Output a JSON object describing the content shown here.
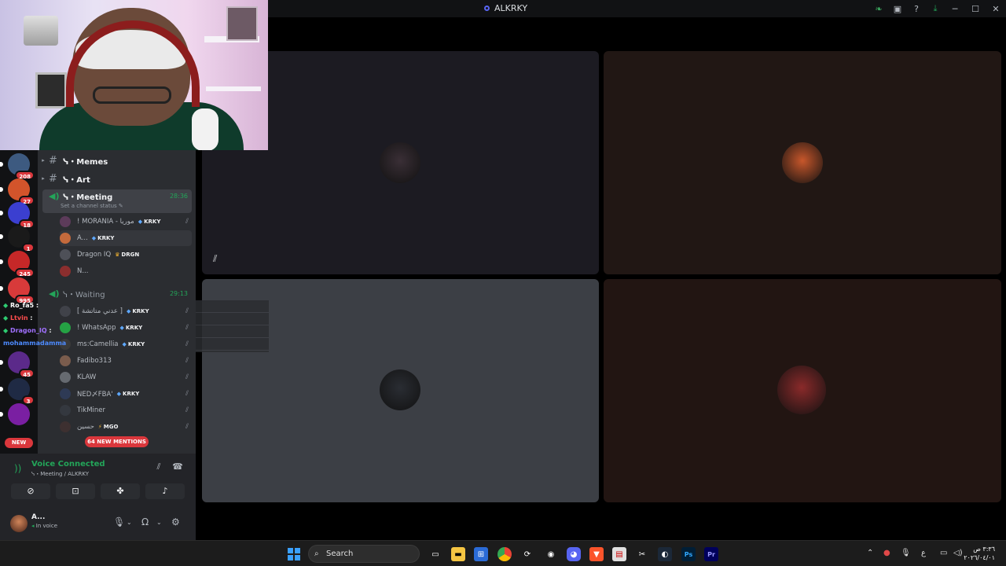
{
  "window": {
    "title": "ALKRKY"
  },
  "guilds": [
    {
      "badge": "208",
      "color": "#3d5a80"
    },
    {
      "badge": "27",
      "color": "#d3542b"
    },
    {
      "badge": "18",
      "color": "#3b3fd0"
    },
    {
      "badge": "1",
      "color": "#1a1a1a"
    },
    {
      "badge": "245",
      "color": "#c62828"
    },
    {
      "badge": "995",
      "color": "#d83a3a"
    },
    {
      "badge": "45",
      "color": "#5b2a8a"
    },
    {
      "badge": "3",
      "color": "#1f2a44"
    },
    {
      "badge": "",
      "color": "#7a1fa2"
    }
  ],
  "guild_new_label": "NEW",
  "channels": {
    "memes": "ᓭ・Memes",
    "art": "ᓭ・Art",
    "meeting": {
      "name": "ᓭ・Meeting",
      "time": "28:36",
      "status": "Set a channel status"
    },
    "meeting_users": [
      {
        "name": "! MORANIA - موريا",
        "tag": "KRKY",
        "tag_icon": "gem",
        "muted": true,
        "color": "#5c3b5a"
      },
      {
        "name": "A...",
        "tag": "KRKY",
        "tag_icon": "gem",
        "muted": false,
        "color": "#c46a3c"
      },
      {
        "name": "Dragon IQ",
        "tag": "DRGN",
        "tag_icon": "crown",
        "muted": false,
        "color": "#4e5058"
      },
      {
        "name": "N...",
        "tag": "",
        "tag_icon": "",
        "muted": false,
        "color": "#8b2e2e"
      }
    ],
    "waiting": {
      "name": "ᓭ・Waiting",
      "time": "29:13"
    },
    "waiting_users": [
      {
        "name": "[ عدني متاتشة ]",
        "tag": "KRKY",
        "tag_icon": "gem",
        "muted": true,
        "color": "#404249"
      },
      {
        "name": "! WhatsApp",
        "tag": "KRKY",
        "tag_icon": "gem",
        "muted": true,
        "color": "#25a244"
      },
      {
        "name": "ms:Camellia",
        "tag": "KRKY",
        "tag_icon": "gem",
        "muted": true,
        "color": "#3a3a3a"
      },
      {
        "name": "Fadibo313",
        "tag": "",
        "tag_icon": "",
        "muted": true,
        "color": "#7a5c4d"
      },
      {
        "name": "KLAW",
        "tag": "",
        "tag_icon": "",
        "muted": true,
        "color": "#666a70"
      },
      {
        "name": "NED〆FBA'",
        "tag": "KRKY",
        "tag_icon": "gem",
        "muted": true,
        "color": "#2e3a55"
      },
      {
        "name": "TikMiner",
        "tag": "",
        "tag_icon": "",
        "muted": true,
        "color": "#34383f"
      },
      {
        "name": "حسين",
        "tag": "MGO",
        "tag_icon": "bolt",
        "muted": true,
        "color": "#3d3030"
      }
    ],
    "mentions_label": "64 NEW MENTIONS"
  },
  "chat_overlay": [
    {
      "user": "Ro_fa5",
      "text": ":",
      "color": "#ffffff"
    },
    {
      "user": "Ltvin",
      "text": ":",
      "color": "#ff4d4d"
    },
    {
      "user": "Dragon_IQ",
      "text": ":",
      "color": "#a070ff"
    },
    {
      "user": "mohammadamma",
      "text": "",
      "color": "#4d8bff"
    }
  ],
  "voice": {
    "title": "Voice Connected",
    "location": "ᓭ・Meeting / ALKRKY"
  },
  "user": {
    "name": "A...",
    "status": "In voice"
  },
  "stage_tiles": [
    {
      "bg": "#1c1b22",
      "avatar": "#3a2f36",
      "mute": true
    },
    {
      "bg": "#211714",
      "avatar": "#c8572b",
      "mute": false
    },
    {
      "bg": "#3c3f45",
      "avatar": "#2a2d33",
      "mute": false
    },
    {
      "bg": "#221512",
      "avatar": "#8a2a2a",
      "mute": false
    }
  ],
  "taskbar": {
    "search_placeholder": "Search",
    "clock_time": "٣:٣٦ ص",
    "clock_date": "٢٠٢٦/٠٤/٠١",
    "lang": "ع"
  },
  "colors": {
    "accent_green": "#23a559",
    "accent_red": "#da373c",
    "sidebar_bg": "#2b2d31",
    "panel_bg": "#232428"
  }
}
